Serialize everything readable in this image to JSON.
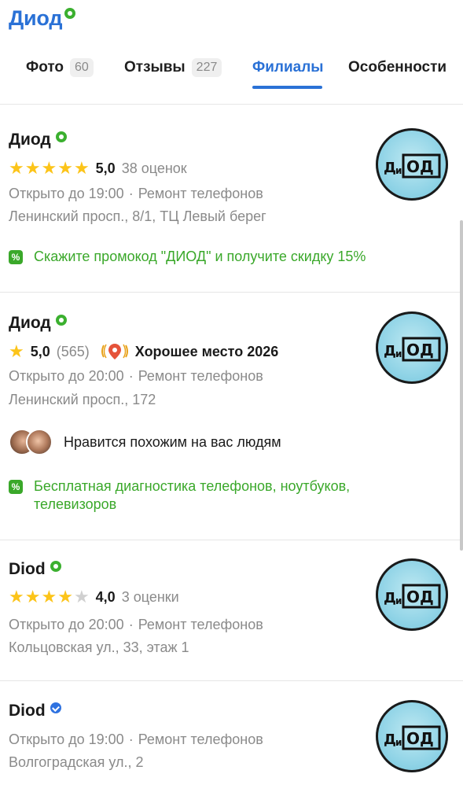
{
  "header": {
    "title": "Диод",
    "tabs": [
      {
        "label": "Фото",
        "count": "60"
      },
      {
        "label": "Отзывы",
        "count": "227"
      },
      {
        "label": "Филиалы",
        "count": ""
      },
      {
        "label": "Особенности",
        "count": ""
      }
    ],
    "active_tab": "Филиалы"
  },
  "cards": [
    {
      "name": "Диод",
      "verified": "green",
      "stars": 5,
      "rating": "5,0",
      "rating_count": "38 оценок",
      "hours": "Открыто до 19:00",
      "separator": "·",
      "category": "Ремонт телефонов",
      "address": "Ленинский просп., 8/1, ТЦ Левый берег",
      "promo": "Скажите промокод \"ДИОД\" и получите скидку 15%"
    },
    {
      "name": "Диод",
      "verified": "green",
      "stars": 1,
      "rating": "5,0",
      "rating_count": "(565)",
      "award": "Хорошее место 2026",
      "hours": "Открыто до 20:00",
      "separator": "·",
      "category": "Ремонт телефонов",
      "address": "Ленинский просп., 172",
      "social": "Нравится похожим на вас людям",
      "promo_line1": "Бесплатная диагностика телефонов, ноутбуков,",
      "promo_line2": "телевизоров"
    },
    {
      "name": "Diod",
      "verified": "green",
      "stars": 4,
      "rating": "4,0",
      "rating_count": "3 оценки",
      "hours": "Открыто до 20:00",
      "separator": "·",
      "category": "Ремонт телефонов",
      "address": "Кольцовская ул., 33, этаж 1"
    },
    {
      "name": "Diod",
      "verified": "blue",
      "hours": "Открыто до 19:00",
      "separator": "·",
      "category": "Ремонт телефонов",
      "address": "Волгоградская ул., 2"
    }
  ],
  "logo_text": "ДиОД",
  "colors": {
    "accent": "#2a71d6",
    "green": "#3aa82a",
    "star": "#fcc419"
  }
}
